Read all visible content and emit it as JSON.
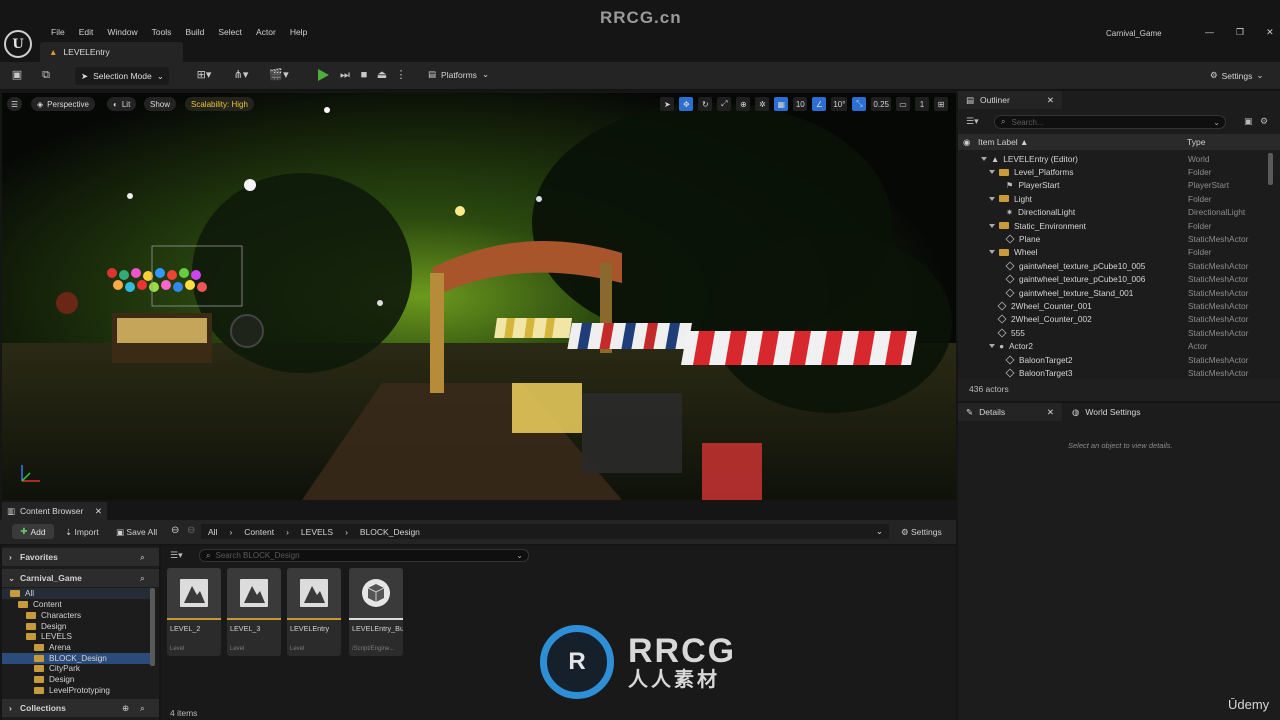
{
  "watermark": "RRCG.cn",
  "menu": [
    "File",
    "Edit",
    "Window",
    "Tools",
    "Build",
    "Select",
    "Actor",
    "Help"
  ],
  "project_name": "Carnival_Game",
  "level_tab": "LEVELEntry",
  "toolbar": {
    "selection_mode": "Selection Mode",
    "platforms": "Platforms",
    "settings": "Settings"
  },
  "viewport": {
    "perspective": "Perspective",
    "lit": "Lit",
    "show": "Show",
    "scalability": "Scalability: High",
    "grid_snap": "10",
    "rot_snap": "10°",
    "scale_snap": "0.25",
    "cam_speed": "1"
  },
  "outliner": {
    "tab": "Outliner",
    "search_placeholder": "Search...",
    "col_label": "Item Label ▲",
    "col_type": "Type",
    "rows": [
      {
        "name": "LEVELEntry (Editor)",
        "type": "World"
      },
      {
        "name": "Level_Platforms",
        "type": "Folder"
      },
      {
        "name": "PlayerStart",
        "type": "PlayerStart"
      },
      {
        "name": "Light",
        "type": "Folder"
      },
      {
        "name": "DirectionalLight",
        "type": "DirectionalLight"
      },
      {
        "name": "Static_Environment",
        "type": "Folder"
      },
      {
        "name": "Plane",
        "type": "StaticMeshActor"
      },
      {
        "name": "Wheel",
        "type": "Folder"
      },
      {
        "name": "gaintwheel_texture_pCube10_005",
        "type": "StaticMeshActor"
      },
      {
        "name": "gaintwheel_texture_pCube10_006",
        "type": "StaticMeshActor"
      },
      {
        "name": "gaintwheel_texture_Stand_001",
        "type": "StaticMeshActor"
      },
      {
        "name": "2Wheel_Counter_001",
        "type": "StaticMeshActor"
      },
      {
        "name": "2Wheel_Counter_002",
        "type": "StaticMeshActor"
      },
      {
        "name": "555",
        "type": "StaticMeshActor"
      },
      {
        "name": "Actor2",
        "type": "Actor"
      },
      {
        "name": "BaloonTarget2",
        "type": "StaticMeshActor"
      },
      {
        "name": "BaloonTarget3",
        "type": "StaticMeshActor"
      }
    ],
    "actor_count": "436 actors"
  },
  "details": {
    "tab": "Details",
    "world_settings": "World Settings",
    "hint": "Select an object to view details."
  },
  "content_browser": {
    "tab": "Content Browser",
    "add": "Add",
    "import": "Import",
    "save_all": "Save All",
    "breadcrumbs": [
      "All",
      "Content",
      "LEVELS",
      "BLOCK_Design"
    ],
    "settings": "Settings",
    "favorites": "Favorites",
    "project": "Carnival_Game",
    "search_placeholder": "Search BLOCK_Design",
    "tree": [
      "All",
      "Content",
      "Characters",
      "Design",
      "LEVELS",
      "Arena",
      "BLOCK_Design",
      "CityPark",
      "Design",
      "LevelPrototyping"
    ],
    "collections": "Collections",
    "assets": [
      {
        "name": "LEVEL_2",
        "type": "Level"
      },
      {
        "name": "LEVEL_3",
        "type": "Level"
      },
      {
        "name": "LEVELEntry",
        "type": "Level"
      },
      {
        "name": "LEVELEntry_BuiltData",
        "type": "/Script/Engine..."
      }
    ],
    "item_count": "4 items"
  },
  "brand": {
    "rrcg": "RRCG",
    "cn": "人人素材",
    "udemy": "Ūdemy"
  }
}
